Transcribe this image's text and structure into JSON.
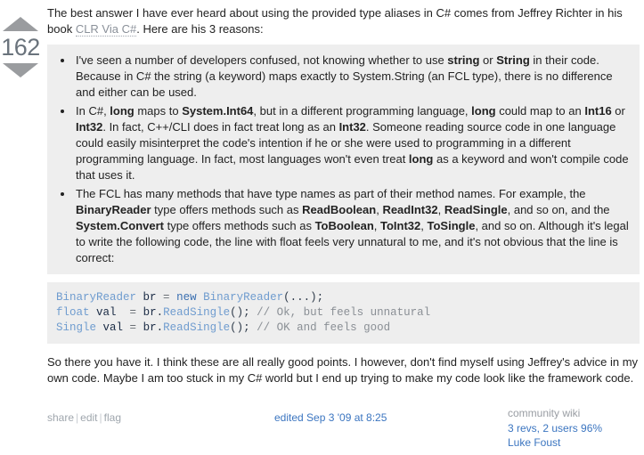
{
  "vote": {
    "up_icon": "arrow-up-triangle-icon",
    "down_icon": "arrow-down-triangle-icon",
    "count": "162"
  },
  "post": {
    "intro_before_link": "The best answer I have ever heard about using the provided type aliases in C# comes from Jeffrey Richter in his book ",
    "intro_link": "CLR Via C#",
    "intro_after_link": ". Here are his 3 reasons:",
    "reasons": [
      {
        "parts": [
          {
            "t": "I've seen a number of developers confused, not knowing whether to use ",
            "b": false
          },
          {
            "t": "string",
            "b": true
          },
          {
            "t": " or ",
            "b": false
          },
          {
            "t": "String",
            "b": true
          },
          {
            "t": " in their code. Because in C# the string (a keyword) maps exactly to System.String (an FCL type), there is no difference and either can be used.",
            "b": false
          }
        ]
      },
      {
        "parts": [
          {
            "t": "In C#, ",
            "b": false
          },
          {
            "t": "long",
            "b": true
          },
          {
            "t": " maps to ",
            "b": false
          },
          {
            "t": "System.Int64",
            "b": true
          },
          {
            "t": ", but in a different programming language, ",
            "b": false
          },
          {
            "t": "long",
            "b": true
          },
          {
            "t": " could map to an ",
            "b": false
          },
          {
            "t": "Int16",
            "b": true
          },
          {
            "t": " or ",
            "b": false
          },
          {
            "t": "Int32",
            "b": true
          },
          {
            "t": ". In fact, C++/CLI does in fact treat long as an ",
            "b": false
          },
          {
            "t": "Int32",
            "b": true
          },
          {
            "t": ". Someone reading source code in one language could easily misinterpret the code's intention if he or she were used to programming in a different programming language. In fact, most languages won't even treat ",
            "b": false
          },
          {
            "t": "long",
            "b": true
          },
          {
            "t": " as a keyword and won't compile code that uses it.",
            "b": false
          }
        ]
      },
      {
        "parts": [
          {
            "t": "The FCL has many methods that have type names as part of their method names. For example, the ",
            "b": false
          },
          {
            "t": "BinaryReader",
            "b": true
          },
          {
            "t": " type offers methods such as ",
            "b": false
          },
          {
            "t": "ReadBoolean",
            "b": true
          },
          {
            "t": ", ",
            "b": false
          },
          {
            "t": "ReadInt32",
            "b": true
          },
          {
            "t": ", ",
            "b": false
          },
          {
            "t": "ReadSingle",
            "b": true
          },
          {
            "t": ", and so on, and the ",
            "b": false
          },
          {
            "t": "System.Convert",
            "b": true
          },
          {
            "t": " type offers methods such as ",
            "b": false
          },
          {
            "t": "ToBoolean",
            "b": true
          },
          {
            "t": ", ",
            "b": false
          },
          {
            "t": "ToInt32",
            "b": true
          },
          {
            "t": ", ",
            "b": false
          },
          {
            "t": "ToSingle",
            "b": true
          },
          {
            "t": ", and so on. Although it's legal to write the following code, the line with float feels very unnatural to me, and it's not obvious that the line is correct:",
            "b": false
          }
        ]
      }
    ],
    "code_lines": [
      [
        {
          "t": "BinaryReader",
          "c": "tok-type"
        },
        {
          "t": " ",
          "c": "tok-op"
        },
        {
          "t": "br",
          "c": "tok-var"
        },
        {
          "t": " = ",
          "c": "tok-op"
        },
        {
          "t": "new",
          "c": "tok-kw"
        },
        {
          "t": " ",
          "c": "tok-op"
        },
        {
          "t": "BinaryReader",
          "c": "tok-fn"
        },
        {
          "t": "(...);",
          "c": "tok-punct"
        }
      ],
      [
        {
          "t": "float",
          "c": "tok-type"
        },
        {
          "t": " ",
          "c": "tok-op"
        },
        {
          "t": "val",
          "c": "tok-var"
        },
        {
          "t": "  = ",
          "c": "tok-op"
        },
        {
          "t": "br",
          "c": "tok-var"
        },
        {
          "t": ".",
          "c": "tok-punct"
        },
        {
          "t": "ReadSingle",
          "c": "tok-fn"
        },
        {
          "t": "(); ",
          "c": "tok-punct"
        },
        {
          "t": "// Ok, but feels unnatural",
          "c": "tok-comment"
        }
      ],
      [
        {
          "t": "Single",
          "c": "tok-type"
        },
        {
          "t": " ",
          "c": "tok-op"
        },
        {
          "t": "val",
          "c": "tok-var"
        },
        {
          "t": " = ",
          "c": "tok-op"
        },
        {
          "t": "br",
          "c": "tok-var"
        },
        {
          "t": ".",
          "c": "tok-punct"
        },
        {
          "t": "ReadSingle",
          "c": "tok-fn"
        },
        {
          "t": "(); ",
          "c": "tok-punct"
        },
        {
          "t": "// OK and feels good",
          "c": "tok-comment"
        }
      ]
    ],
    "outro": "So there you have it. I think these are all really good points. I however, don't find myself using Jeffrey's advice in my own code. Maybe I am too stuck in my C# world but I end up trying to make my code look like the framework code."
  },
  "footer": {
    "share_label": "share",
    "edit_label": "edit",
    "flag_label": "flag",
    "separator": "|",
    "edited_text": "edited Sep 3 '09 at 8:25",
    "community_wiki_label": "community wiki",
    "revs_text": "3 revs, 2 users 96%",
    "user_name": "Luke Foust"
  },
  "colors": {
    "link_blue": "#3b75c0",
    "code_bg": "#eeeeee",
    "vote_gray": "#9a9c9f",
    "text": "#222222"
  }
}
